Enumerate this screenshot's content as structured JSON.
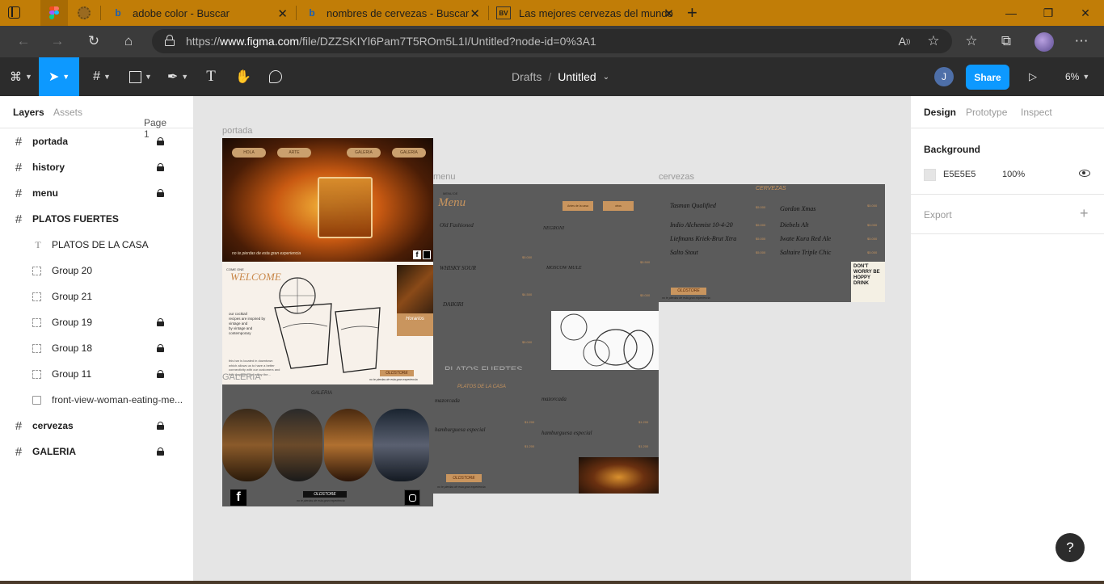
{
  "browser": {
    "tabs": [
      {
        "title": "adobe color - Buscar",
        "icon": "bing-icon"
      },
      {
        "title": "nombres de cervezas - Buscar",
        "icon": "bing-icon"
      },
      {
        "title": "Las mejores cervezas del mundo",
        "icon": "site-favicon"
      }
    ],
    "favicon_bv": "BV",
    "url_prefix": "https://",
    "url_domain": "www.figma.com",
    "url_path": "/file/DZZSKIYl6Pam7T5ROm5L1I/Untitled?node-id=0%3A1",
    "new_tab": "+",
    "colors": {
      "tabbar": "#c17d07",
      "addressbar": "#3b3b3b"
    }
  },
  "toolbar": {
    "breadcrumb_parent": "Drafts",
    "breadcrumb_sep": "/",
    "file_name": "Untitled",
    "avatar_initial": "J",
    "share_label": "Share",
    "zoom": "6%",
    "accent": "#0d99ff"
  },
  "left_panel": {
    "tab_layers": "Layers",
    "tab_assets": "Assets",
    "page": "Page 1",
    "layers": [
      {
        "name": "portada",
        "type": "frame",
        "locked": true,
        "indent": 0
      },
      {
        "name": "history",
        "type": "frame",
        "locked": true,
        "indent": 0
      },
      {
        "name": "menu",
        "type": "frame",
        "locked": true,
        "indent": 0
      },
      {
        "name": "PLATOS FUERTES",
        "type": "frame",
        "locked": false,
        "indent": 0
      },
      {
        "name": "PLATOS DE LA CASA",
        "type": "text",
        "locked": false,
        "indent": 1
      },
      {
        "name": "Group 20",
        "type": "group",
        "locked": false,
        "indent": 1
      },
      {
        "name": "Group 21",
        "type": "group",
        "locked": false,
        "indent": 1
      },
      {
        "name": "Group 19",
        "type": "group",
        "locked": true,
        "indent": 1
      },
      {
        "name": "Group 18",
        "type": "group",
        "locked": true,
        "indent": 1
      },
      {
        "name": "Group 11",
        "type": "group",
        "locked": true,
        "indent": 1
      },
      {
        "name": "front-view-woman-eating-me...",
        "type": "image",
        "locked": false,
        "indent": 1
      },
      {
        "name": "cervezas",
        "type": "frame",
        "locked": true,
        "indent": 0
      },
      {
        "name": "GALERIA",
        "type": "frame",
        "locked": true,
        "indent": 0
      }
    ]
  },
  "canvas": {
    "background": "#e5e5e5",
    "frame_labels": {
      "portada": "portada",
      "menu": "menu",
      "cervezas": "cervezas",
      "galeria": "GALERIA",
      "platos": "PLATOS FUERTES"
    },
    "portada": {
      "nav": [
        "HOLA",
        "ARTE",
        "GALERIA",
        "GALERIA"
      ],
      "tagline": "no te pierdas de esta gran experiencia",
      "welcome_small": "COME ONE",
      "welcome": "WELCOME",
      "copy": [
        "our cocktail",
        "recipes are inspired by",
        "vintage and",
        "by vintage and",
        "contemporary"
      ],
      "copy2": [
        "this bar is located in downtown",
        "which allows us to have a better",
        "connectivity with our customers and",
        "that way they can enjoy the..."
      ],
      "horarios": "Horarios",
      "brand": "OLDSTORE"
    },
    "menu": {
      "header_small": "MENU DE",
      "title": "Menu",
      "buttons": [
        "Antes de la casa",
        "otros"
      ],
      "items_left": [
        "Old Fashioned",
        "WHISKY SOUR",
        "DAIKIRI"
      ],
      "items_right": [
        "NEGRONI",
        "MOSCOW MULE"
      ],
      "prices": [
        "$5.000",
        "$4.500",
        "$5.000",
        "$5.500",
        "$5.000"
      ]
    },
    "platos": {
      "subtitle": "PLATOS DE LA CASA",
      "items": [
        "mazorcada",
        "mazorcada",
        "hamburguesa especial",
        "hamburguesa especial"
      ],
      "price": "$1.200",
      "brand": "OLDSTORE",
      "tagline": "no te pierdas de esta gran experiencia"
    },
    "cervezas": {
      "title": "CERVEZAS",
      "left": [
        "Tasman Qualified",
        "Indio Alchemist 10-4-20",
        "Liefmans Kriek-Brut Xtra",
        "Salto Stout"
      ],
      "right": [
        "Gordon Xmas",
        "Diebels Alt",
        "Iwate Kura Red Ale",
        "Saltaire Triple Chic"
      ],
      "price": "$5.000",
      "brand": "OLDSTORE",
      "tagline": "no te pierdas de esta gran experiencia",
      "poster": "DON'T WORRY BE HOPPY DRINK"
    },
    "galeria": {
      "title": "GALERIA",
      "brand": "OLDSTORE",
      "tagline": "no te pierdas de esta gran experiencia"
    }
  },
  "right_panel": {
    "tab_design": "Design",
    "tab_prototype": "Prototype",
    "tab_inspect": "Inspect",
    "background_label": "Background",
    "bg_hex": "E5E5E5",
    "bg_opacity": "100%",
    "export_label": "Export",
    "export_add": "+"
  },
  "help": "?"
}
